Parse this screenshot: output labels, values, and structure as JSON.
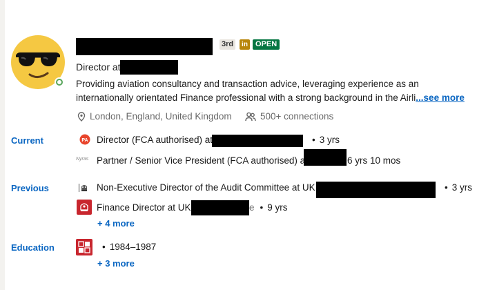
{
  "profile": {
    "degree": "3rd",
    "premium_logo": "in",
    "open_badge": "OPEN",
    "headline": "Director at",
    "summary_line1": "Providing aviation consultancy and transaction advice, leveraging experience as an",
    "summary_line2": "internationally orientated Finance professional with a strong background in the Airli",
    "see_more": "...see more",
    "location": "London, England, United Kingdom",
    "connections": "500+ connections"
  },
  "current": {
    "label": "Current",
    "items": [
      {
        "logo_text": "PA",
        "title": "Director (FCA authorised) at",
        "duration": "3 yrs"
      },
      {
        "logo_text": "Nyras",
        "title": "Partner / Senior Vice President (FCA authorised) at",
        "duration": "6 yrs 10 mos"
      }
    ]
  },
  "previous": {
    "label": "Previous",
    "items": [
      {
        "title": "Non-Executive Director of the Audit Committee at UK",
        "duration": "3 yrs"
      },
      {
        "title": "Finance Director at UK",
        "tail": "e",
        "duration": "9 yrs"
      }
    ],
    "more": "+ 4 more"
  },
  "education": {
    "label": "Education",
    "items": [
      {
        "years": "1984–1987"
      }
    ],
    "more": "+ 3 more"
  },
  "colors": {
    "accent": "#0a66c2",
    "open_green": "#057642",
    "online_green": "#57a55a",
    "emoji_yellow": "#f5c842"
  }
}
